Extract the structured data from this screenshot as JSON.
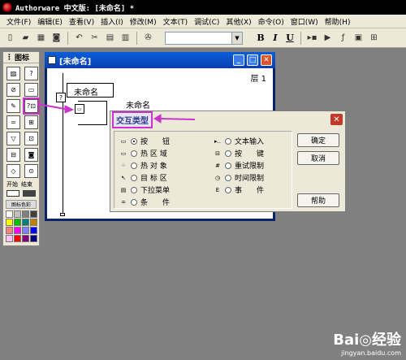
{
  "app": {
    "title": "Authorware 中文版: [未命名] *"
  },
  "menu": [
    "文件(F)",
    "编辑(E)",
    "查看(V)",
    "插入(I)",
    "修改(M)",
    "文本(T)",
    "调试(C)",
    "其他(X)",
    "命令(O)",
    "窗口(W)",
    "帮助(H)"
  ],
  "toolbar": {
    "icons": [
      "new-icon",
      "open-icon",
      "save-all-icon",
      "import-icon",
      "undo-icon",
      "cut-icon",
      "copy-icon",
      "paste-icon",
      "find-icon"
    ],
    "font_combo_value": "",
    "format_letters": [
      "B",
      "I",
      "U"
    ],
    "right_icons": [
      "run-icon",
      "control-panel-icon",
      "functions-icon",
      "variables-icon",
      "knowledge-objects-icon"
    ]
  },
  "palette": {
    "title": "图标",
    "icons": [
      "display-icon",
      "motion-icon",
      "erase-icon",
      "wait-icon",
      "navigate-icon",
      "framework-icon",
      "decision-icon",
      "interaction-icon",
      "calculation-icon",
      "map-icon",
      "digital-movie-icon",
      "sound-icon",
      "video-icon",
      "knowledge-object-icon"
    ],
    "start_label": "开始",
    "end_label": "结束",
    "color_label": "图标色彩",
    "colors": [
      "#ffffff",
      "#c0c0c0",
      "#808080",
      "#404040",
      "#ffff00",
      "#00c000",
      "#008080",
      "#c08000",
      "#ff8080",
      "#ff00ff",
      "#8080ff",
      "#0000ff",
      "#ffc0ff",
      "#ff0000",
      "#800080",
      "#000080"
    ]
  },
  "flow_window": {
    "title": "[未命名]",
    "level": "层 1",
    "map_label": "未命名",
    "icon_title": "未命名"
  },
  "dialog": {
    "title": "交互类型",
    "options_left": [
      {
        "label": "按　　钮",
        "glyph": "▭",
        "selected": true
      },
      {
        "label": "热 区 域",
        "glyph": "▭",
        "selected": false
      },
      {
        "label": "热 对 象",
        "glyph": "⁘",
        "selected": false
      },
      {
        "label": "目 标 区",
        "glyph": "↖",
        "selected": false
      },
      {
        "label": "下拉菜单",
        "glyph": "▤",
        "selected": false
      },
      {
        "label": "条　　件",
        "glyph": "=",
        "selected": false
      }
    ],
    "options_right": [
      {
        "label": "文本输入",
        "glyph": "▸..",
        "selected": false
      },
      {
        "label": "按　　键",
        "glyph": "⊟",
        "selected": false
      },
      {
        "label": "重试限制",
        "glyph": "#",
        "selected": false
      },
      {
        "label": "时间限制",
        "glyph": "◷",
        "selected": false
      },
      {
        "label": "事　　件",
        "glyph": "E",
        "selected": false
      }
    ],
    "ok_label": "确定",
    "cancel_label": "取消",
    "help_label": "帮助"
  },
  "watermark": {
    "brand": "Bai◎经验",
    "url": "jingyan.baidu.com"
  },
  "accent_color": "#cc33cc"
}
